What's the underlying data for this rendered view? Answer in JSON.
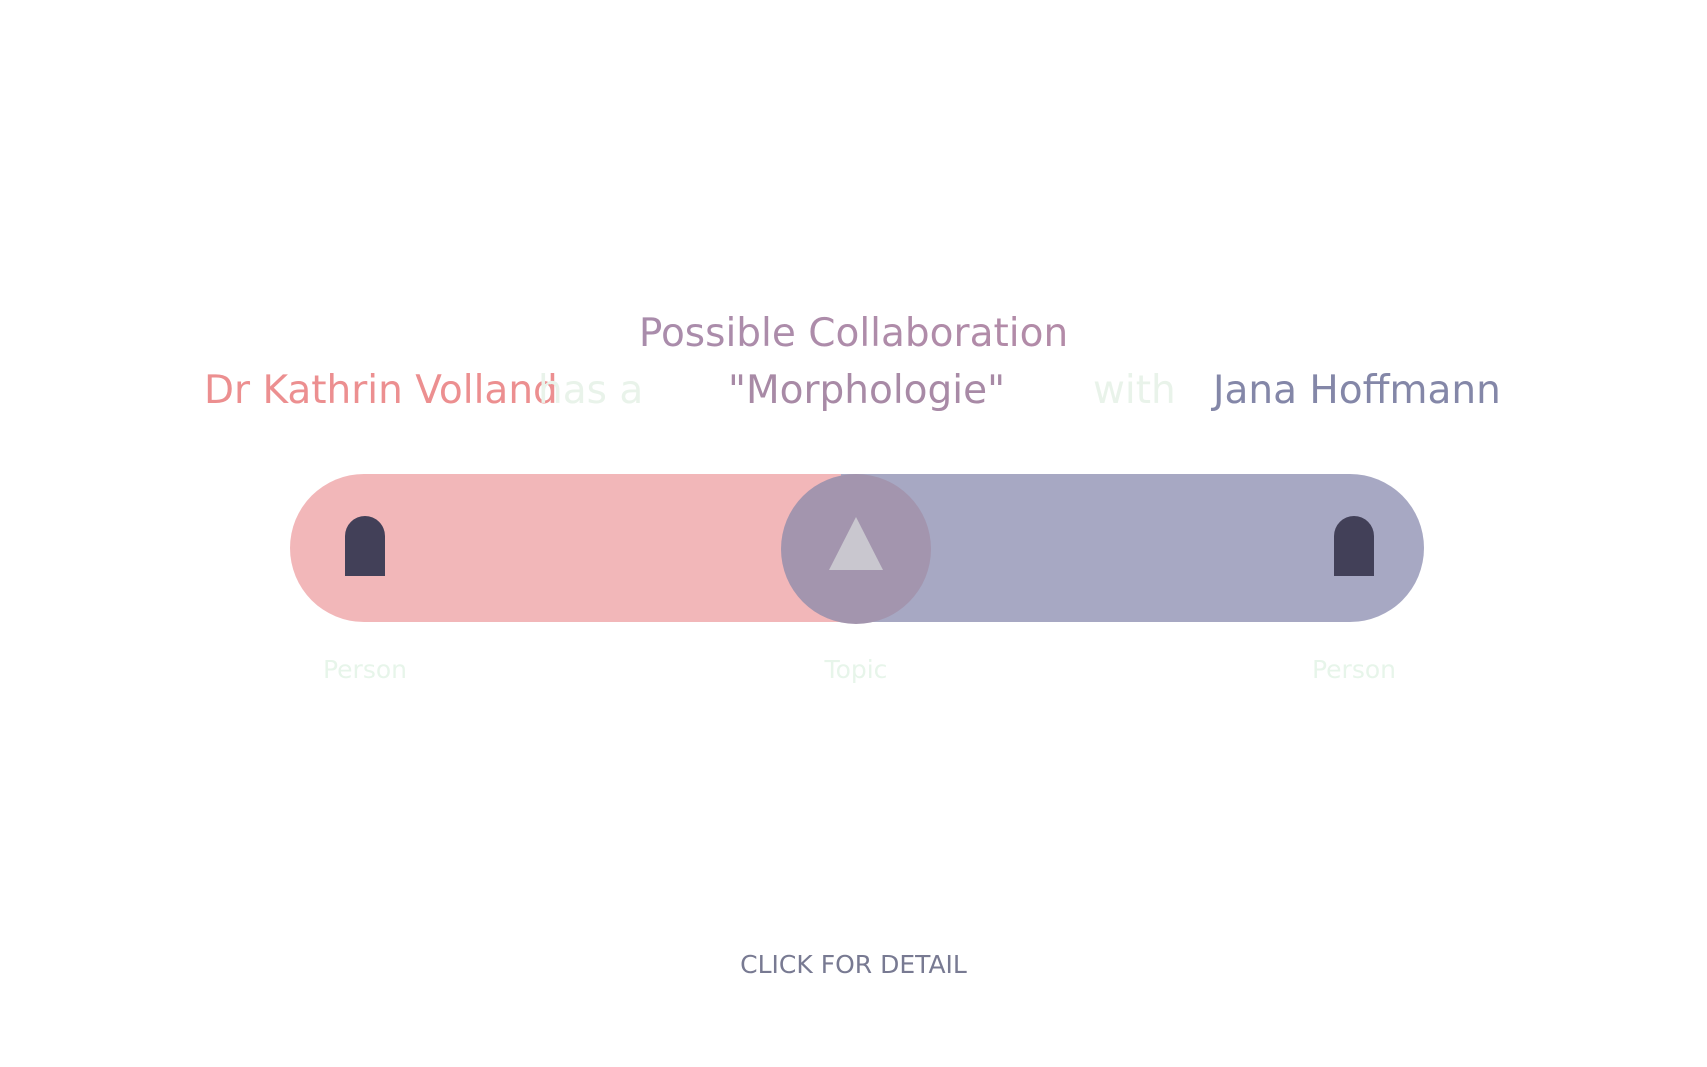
{
  "heading": {
    "title": "Possible Collaboration"
  },
  "sentence": {
    "person_a": "Dr Kathrin Volland",
    "connector_1": "has a",
    "topic": "\"Morphologie\"",
    "connector_2": "with",
    "person_b": "Jana Hoffmann"
  },
  "nodes": {
    "left": {
      "label": "Person",
      "icon": "person-icon"
    },
    "center": {
      "label": "Topic",
      "icon": "triangle-icon"
    },
    "right": {
      "label": "Person",
      "icon": "person-icon"
    }
  },
  "actions": {
    "detail_label": "CLICK FOR DETAIL"
  },
  "colors": {
    "person_a": "#ec8f90",
    "person_b": "#8487a8",
    "topic": "#a88aa6",
    "bar_left": "#f2b7b9",
    "bar_right": "#a7a8c3",
    "topic_circle": "#a395ae",
    "icon_dark": "#424058",
    "connector_text": "#e9f3ea",
    "detail_text": "#787a92"
  }
}
